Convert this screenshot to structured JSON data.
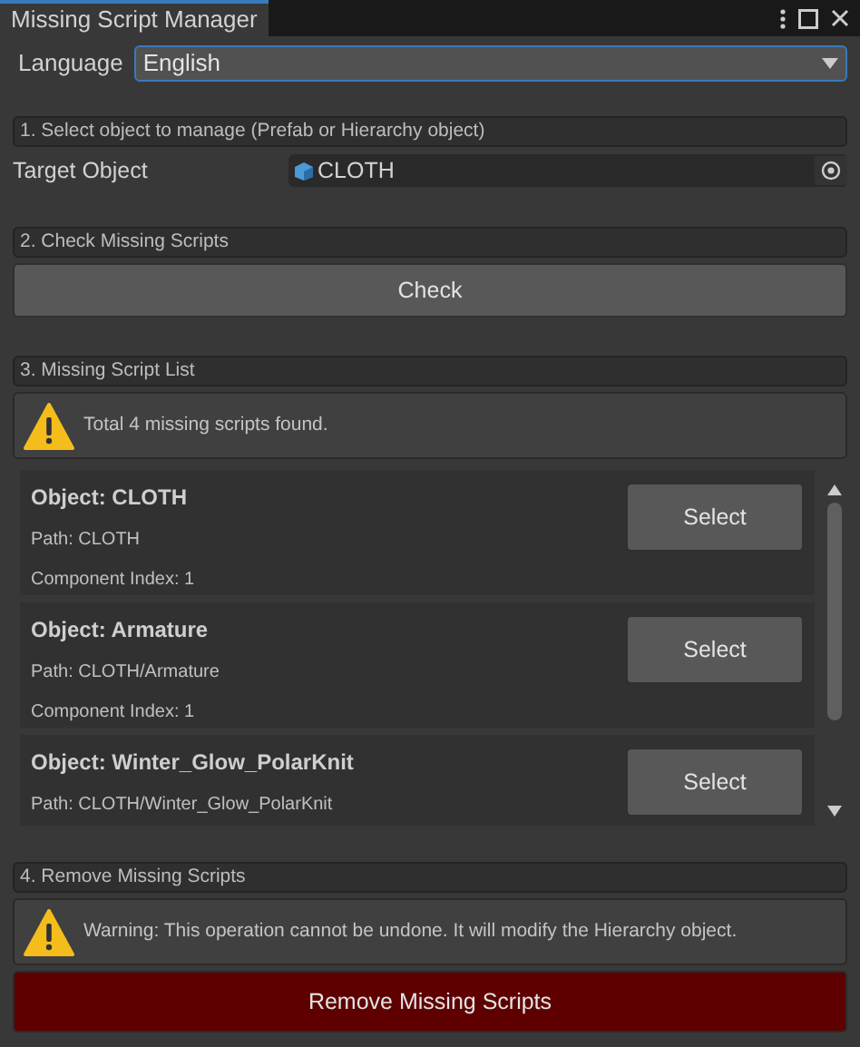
{
  "window": {
    "title": "Missing Script Manager"
  },
  "language": {
    "label": "Language",
    "value": "English"
  },
  "sections": [
    {
      "header": "1. Select object to manage (Prefab or Hierarchy object)"
    },
    {
      "header": "2. Check Missing Scripts"
    },
    {
      "header": "3. Missing Script List"
    },
    {
      "header": "4. Remove Missing Scripts"
    }
  ],
  "target": {
    "label": "Target Object",
    "value": "CLOTH"
  },
  "check_button": "Check",
  "list_message": "Total 4 missing scripts found.",
  "items": [
    {
      "object": "Object: CLOTH",
      "path": "Path: CLOTH",
      "index": "Component Index: 1",
      "button": "Select"
    },
    {
      "object": "Object: Armature",
      "path": "Path: CLOTH/Armature",
      "index": "Component Index: 1",
      "button": "Select"
    },
    {
      "object": "Object: Winter_Glow_PolarKnit",
      "path": "Path: CLOTH/Winter_Glow_PolarKnit",
      "button": "Select"
    }
  ],
  "warning": "Warning: This operation cannot be undone. It will modify the Hierarchy object.",
  "remove_button": "Remove Missing Scripts"
}
